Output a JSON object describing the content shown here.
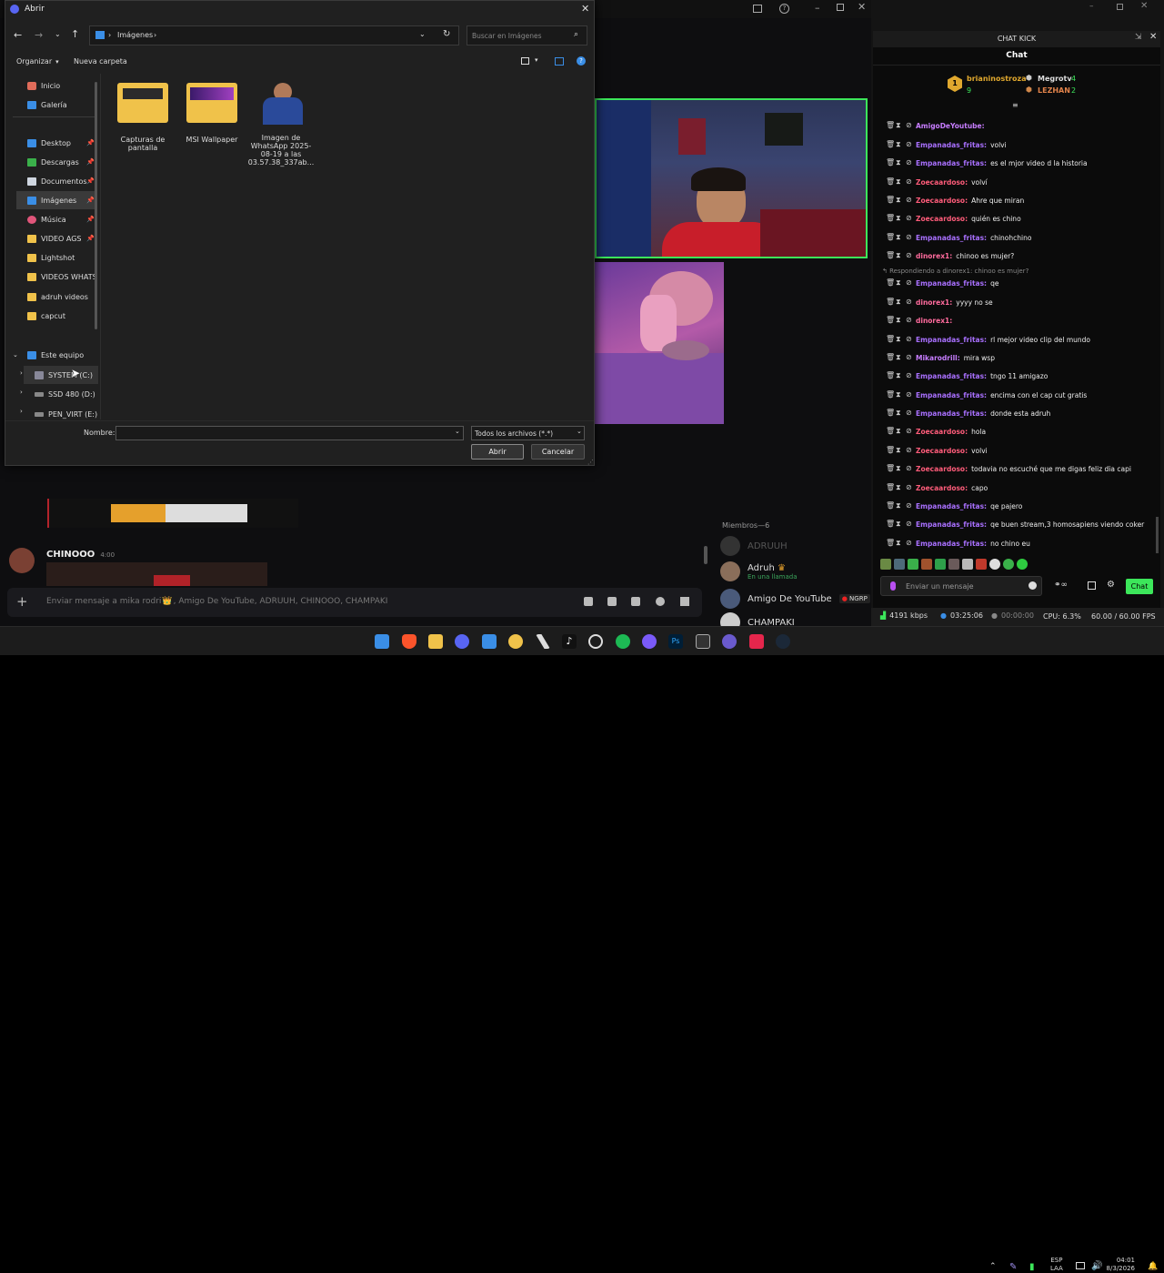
{
  "stream_window": {
    "status_bar": {
      "bitrate": "4191 kbps",
      "time1": "03:25:06",
      "time2": "00:00:00",
      "cpu": "CPU: 6.3%",
      "fps": "60.00 / 60.00 FPS"
    }
  },
  "dialog": {
    "title": "Abrir",
    "path": "Imágenes",
    "search_placeholder": "Buscar en Imágenes",
    "toolbar": {
      "organize": "Organizar",
      "new_folder": "Nueva carpeta"
    },
    "nav": [
      {
        "label": "Inicio"
      },
      {
        "label": "Galería"
      },
      {
        "label": "Desktop"
      },
      {
        "label": "Descargas"
      },
      {
        "label": "Documentos"
      },
      {
        "label": "Imágenes"
      },
      {
        "label": "Música"
      },
      {
        "label": "VIDEO AGS"
      },
      {
        "label": "Lightshot"
      },
      {
        "label": "VIDEOS WHATS"
      },
      {
        "label": "adruh videos"
      },
      {
        "label": "capcut"
      },
      {
        "label": "Este equipo"
      },
      {
        "label": "SYSTEM (C:)"
      },
      {
        "label": "SSD 480 (D:)"
      },
      {
        "label": "PEN_VIRT (E:)"
      }
    ],
    "files": [
      {
        "name": "Capturas de pantalla"
      },
      {
        "name": "MSI Wallpaper"
      },
      {
        "name": "Imagen de WhatsApp 2025-08-19 a las 03.57.38_337ab..."
      }
    ],
    "filename_label": "Nombre:",
    "filter": "Todos los archivos (*.*)",
    "open_button": "Abrir",
    "cancel_button": "Cancelar"
  },
  "discord": {
    "message_author": "CHINOOO",
    "message_time": "4:00",
    "input_placeholder": "Enviar mensaje a mika rodri",
    "input_suffix": ", Amigo De YouTube, ADRUUH, CHINOOO, CHAMPAKI",
    "members_header": "Miembros—6",
    "members": [
      {
        "name": "ADRUUH"
      },
      {
        "name": "Adruh",
        "status": "En una llamada"
      },
      {
        "name": "Amigo De YouTube",
        "tag": "NGRP"
      },
      {
        "name": "CHAMPAKI"
      }
    ]
  },
  "chat": {
    "window_title": "CHAT KICK",
    "tab": "Chat",
    "leaders": [
      {
        "name": "brianinostroza",
        "count": "9"
      },
      {
        "name": "Megrotv",
        "count": "4"
      },
      {
        "name": "LEZHAN",
        "count": "2"
      }
    ],
    "reply_note": "Respondiendo a dinorex1: chinoo es mujer?",
    "messages": [
      {
        "user": "AmigoDeYoutube",
        "text": "",
        "color": "#c77dff"
      },
      {
        "user": "Empanadas_fritas",
        "text": "volvi",
        "color": "#a970ff"
      },
      {
        "user": "Empanadas_fritas",
        "text": "es el mjor video d la historia",
        "color": "#a970ff"
      },
      {
        "user": "Zoecaardoso",
        "text": "volví",
        "color": "#ff5c7a"
      },
      {
        "user": "Zoecaardoso",
        "text": "Ahre que miran",
        "color": "#ff5c7a"
      },
      {
        "user": "Zoecaardoso",
        "text": "quién es chino",
        "color": "#ff5c7a"
      },
      {
        "user": "Empanadas_fritas",
        "text": "chinohchino",
        "color": "#a970ff"
      },
      {
        "user": "dinorex1",
        "text": "chinoo es mujer?",
        "color": "#ff6b9d"
      },
      {
        "user": "Empanadas_fritas",
        "text": "qe",
        "color": "#a970ff"
      },
      {
        "user": "dinorex1",
        "text": "yyyy no se",
        "color": "#ff6b9d"
      },
      {
        "user": "dinorex1",
        "text": "",
        "color": "#ff6b9d"
      },
      {
        "user": "Empanadas_fritas",
        "text": "rl mejor video clip del mundo",
        "color": "#a970ff"
      },
      {
        "user": "Mikarodrill",
        "text": "mira wsp",
        "color": "#c77dff"
      },
      {
        "user": "Empanadas_fritas",
        "text": "tngo 11 amigazo",
        "color": "#a970ff"
      },
      {
        "user": "Empanadas_fritas",
        "text": "encima con el cap cut gratis",
        "color": "#a970ff"
      },
      {
        "user": "Empanadas_fritas",
        "text": "donde esta adruh",
        "color": "#a970ff"
      },
      {
        "user": "Zoecaardoso",
        "text": "hola",
        "color": "#ff5c7a"
      },
      {
        "user": "Zoecaardoso",
        "text": "volvi",
        "color": "#ff5c7a"
      },
      {
        "user": "Zoecaardoso",
        "text": "todavia no escuché que me digas feliz dia capi",
        "color": "#ff5c7a"
      },
      {
        "user": "Zoecaardoso",
        "text": "capo",
        "color": "#ff5c7a"
      },
      {
        "user": "Empanadas_fritas",
        "text": "qe pajero",
        "color": "#a970ff"
      },
      {
        "user": "Empanadas_fritas",
        "text": "qe buen stream,3 homosapiens viendo coker",
        "color": "#a970ff"
      },
      {
        "user": "Empanadas_fritas",
        "text": "no chino eu",
        "color": "#a970ff"
      }
    ],
    "input_placeholder": "Enviar un mensaje",
    "send_button": "Chat"
  },
  "taskbar": {
    "lang": "ESP",
    "lang2": "LAA",
    "time": "04:01",
    "date": "8/3/2026"
  }
}
